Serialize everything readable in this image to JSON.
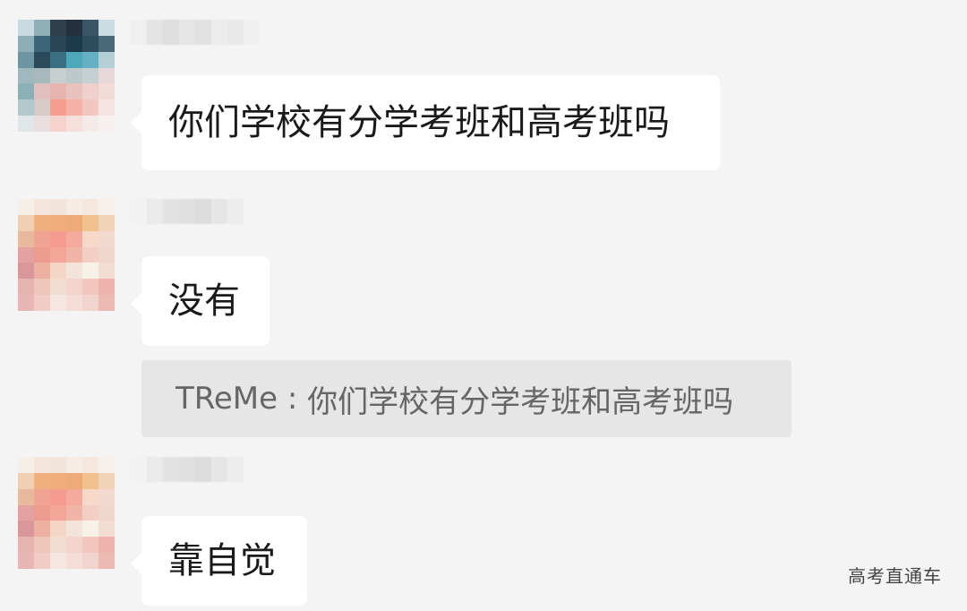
{
  "messages": [
    {
      "text": "你们学校有分学考班和高考班吗"
    },
    {
      "text": "没有"
    },
    {
      "text": "靠自觉"
    }
  ],
  "quote": {
    "author": "TReMe",
    "separator": " : ",
    "text": "你们学校有分学考班和高考班吗"
  },
  "watermark": "高考直通车"
}
